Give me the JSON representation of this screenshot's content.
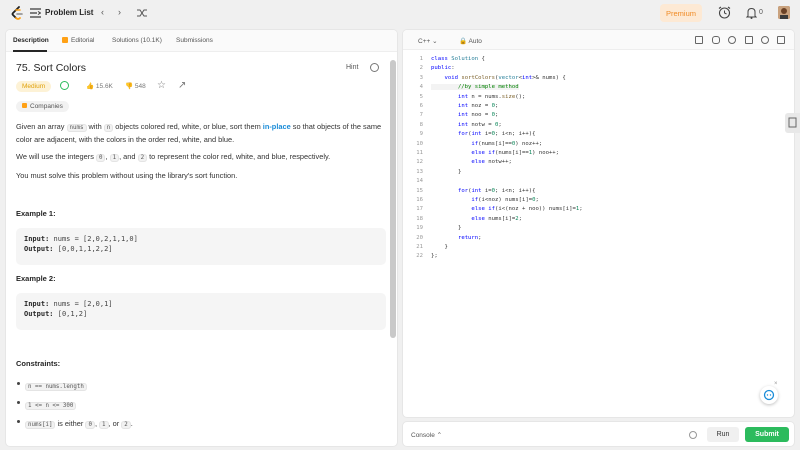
{
  "nav": {
    "title": "Problem List",
    "prev": "‹",
    "next": "›",
    "premium": "Premium",
    "notif_count": "0"
  },
  "tabs": {
    "description": "Description",
    "editorial": "Editorial",
    "solutions": "Solutions (10.1K)",
    "submissions": "Submissions"
  },
  "problem": {
    "title": "75. Sort Colors",
    "hint": "Hint",
    "difficulty": "Medium",
    "likes": "15.6K",
    "dislikes": "548",
    "companies": "Companies",
    "p1_a": "Given an array ",
    "p1_code1": "nums",
    "p1_b": " with ",
    "p1_code2": "n",
    "p1_c": " objects colored red, white, or blue, sort them ",
    "p1_link": "in-place",
    "p1_d": " so that objects of the same color are adjacent, with the colors in the order red, white, and blue.",
    "p2_a": "We will use the integers ",
    "p2_c0": "0",
    "p2_sep1": ", ",
    "p2_c1": "1",
    "p2_sep2": ", and ",
    "p2_c2": "2",
    "p2_b": " to represent the color red, white, and blue, respectively.",
    "p3": "You must solve this problem without using the library's sort function."
  },
  "examples": [
    {
      "heading": "Example 1:",
      "input_label": "Input:",
      "input": " nums = [2,0,2,1,1,0]",
      "output_label": "Output:",
      "output": " [0,0,1,1,2,2]"
    },
    {
      "heading": "Example 2:",
      "input_label": "Input:",
      "input": " nums = [2,0,1]",
      "output_label": "Output:",
      "output": " [0,1,2]"
    }
  ],
  "constraints": {
    "heading": "Constraints:",
    "c1": "n == nums.length",
    "c2": "1 <= n <= 300",
    "c3_code": "nums[i]",
    "c3_a": " is either ",
    "c3_0": "0",
    "c3_sep1": ", ",
    "c3_1": "1",
    "c3_sep2": ", or ",
    "c3_2": "2",
    "c3_end": "."
  },
  "editor": {
    "language": "C++",
    "mode": "Auto",
    "lines": [
      "class Solution {",
      "public:",
      "    void sortColors(vector<int>& nums) {",
      "        //by simple method",
      "        int n = nums.size();",
      "        int noz = 0;",
      "        int noo = 0;",
      "        int notw = 0;",
      "        for(int i=0; i<n; i++){",
      "            if(nums[i]==0) noz++;",
      "            else if(nums[i]==1) noo++;",
      "            else notw++;",
      "        }",
      "",
      "        for(int i=0; i<n; i++){",
      "            if(i<noz) nums[i]=0;",
      "            else if(i<(noz + noo)) nums[i]=1;",
      "            else nums[i]=2;",
      "        }",
      "        return;",
      "    }",
      "};"
    ]
  },
  "console": {
    "label": "Console",
    "run": "Run",
    "submit": "Submit"
  },
  "colors": {
    "accent_green": "#2cbb5d",
    "medium": "#e0a10a",
    "premium": "#f08a24",
    "link": "#1a8cd8"
  }
}
